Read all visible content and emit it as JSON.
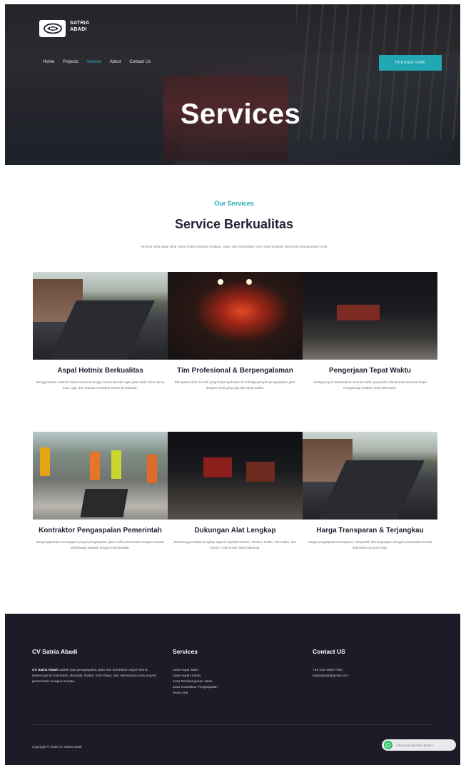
{
  "brand": {
    "name_line1": "SATRIA",
    "name_line2": "ABADI"
  },
  "nav": {
    "items": [
      "Home",
      "Projects",
      "Service",
      "About",
      "Contact Us"
    ],
    "active_index": 2
  },
  "hero": {
    "cta_label": "HUBUNGI KAMI",
    "title": "Services"
  },
  "section": {
    "eyebrow": "Our Services",
    "title": "Service Berkualitas",
    "description": "Temukan jasa aspal yang Satria Abadi tawarkan lengkap, cepat, dan berkualitas. Kami siap melayani kebutuhan pengaspalan Anda."
  },
  "services": [
    {
      "title": "Aspal Hotmix Berkualitas",
      "text": "Menggunakan material hotmix bermutu tinggi sesuai standar agar jalan lebih tahan lama, kuat, rapi, dan mampu menahan beban kendaraan."
    },
    {
      "title": "Tim Profesional & Berpengalaman",
      "text": "Dikerjakan oleh tim ahli yang berpengalaman di berbagai proyek pengaspalan jalan dengan hasil yang rapi dan tepat waktu."
    },
    {
      "title": "Pengerjaan Tepat Waktu",
      "text": "Setiap proyek diselesaikan sesuai waktu yang telah disepakati bersama tanpa mengurangi kualitas hasil pekerjaan."
    },
    {
      "title": "Kontraktor Pengaspalan Pemerintah",
      "text": "Berpengalaman menangani proyek pengaspalan jalan milik pemerintah maupun swasta di berbagai wilayah dengan hasil terbaik."
    },
    {
      "title": "Dukungan Alat Lengkap",
      "text": "Didukung peralatan lengkap seperti Asphalt Finisher, Tandem Roller, Tire Roller, dan Dump Truck untuk hasil maksimal."
    },
    {
      "title": "Harga Transparan & Terjangkau",
      "text": "Harga pengaspalan transparan, kompetitif, dan terjangkau dengan penawaran sesuai kebutuhan proyek Anda."
    }
  ],
  "footer": {
    "col1_title": "CV Satria Abadi",
    "col1_strong": "CV Satria Abadi",
    "col1_text": "adalah jasa pengaspalan jalan dan kontraktor aspal hotmix terpercaya di Sukoharjo, Boyolali, Klaten, Solo Raya, dan sekitarnya untuk proyek pemerintah maupun swasta.",
    "col2_title": "Services",
    "col2_items": [
      "Jasa Aspal Jalan",
      "Jasa Aspal Hotmix",
      "Jasa Pembangunan Jalan",
      "Jasa Kontraktor Pengaspalan",
      "Sewa Alat"
    ],
    "col3_title": "Contact US",
    "col3_items": [
      "+62 812-3456-7890",
      "satriaabadi@gmail.com"
    ],
    "copyright": "Copyright © 2025 CV Satria Abadi",
    "whatsapp_label": "Ada yang bisa kami bantu?"
  },
  "colors": {
    "accent": "#22a7b5",
    "footer_bg": "#1c1b27",
    "title_dark": "#1f2230",
    "whatsapp": "#25c35b"
  }
}
